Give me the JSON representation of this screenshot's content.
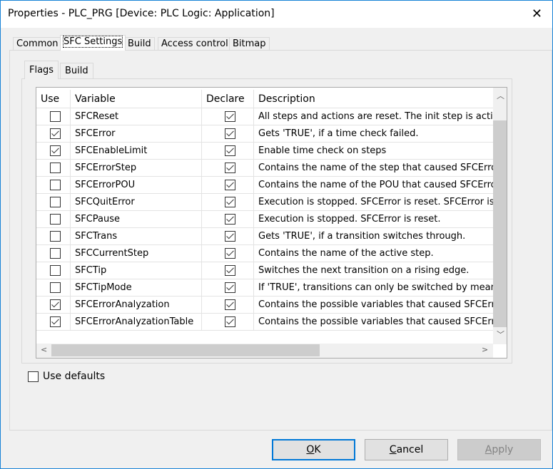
{
  "window": {
    "title": "Properties - PLC_PRG [Device: PLC Logic: Application]",
    "close_icon": "close-icon"
  },
  "tabs": [
    {
      "label": "Common"
    },
    {
      "label": "SFC Settings",
      "active": true
    },
    {
      "label": "Build"
    },
    {
      "label": "Access control"
    },
    {
      "label": "Bitmap"
    }
  ],
  "subtabs": [
    {
      "label": "Flags",
      "active": true
    },
    {
      "label": "Build"
    }
  ],
  "table": {
    "columns": [
      "Use",
      "Variable",
      "Declare",
      "Description"
    ],
    "rows": [
      {
        "use": false,
        "variable": "SFCReset",
        "declare": true,
        "description": "All steps and actions are reset. The init step is activated"
      },
      {
        "use": true,
        "variable": "SFCError",
        "declare": true,
        "description": "Gets 'TRUE', if a time check failed."
      },
      {
        "use": true,
        "variable": "SFCEnableLimit",
        "declare": true,
        "description": "Enable time check on steps"
      },
      {
        "use": false,
        "variable": "SFCErrorStep",
        "declare": true,
        "description": "Contains the name of the step that caused SFCError t"
      },
      {
        "use": false,
        "variable": "SFCErrorPOU",
        "declare": true,
        "description": "Contains the name of the POU that caused SFCError t"
      },
      {
        "use": false,
        "variable": "SFCQuitError",
        "declare": true,
        "description": "Execution is stopped. SFCError is reset. SFCError is re"
      },
      {
        "use": false,
        "variable": "SFCPause",
        "declare": true,
        "description": "Execution is stopped. SFCError is reset."
      },
      {
        "use": false,
        "variable": "SFCTrans",
        "declare": true,
        "description": "Gets 'TRUE', if a transition switches through."
      },
      {
        "use": false,
        "variable": "SFCCurrentStep",
        "declare": true,
        "description": "Contains the name of the active step."
      },
      {
        "use": false,
        "variable": "SFCTip",
        "declare": true,
        "description": "Switches the next transition on a rising edge."
      },
      {
        "use": false,
        "variable": "SFCTipMode",
        "declare": true,
        "description": "If 'TRUE', transitions can only be switched by means c"
      },
      {
        "use": true,
        "variable": "SFCErrorAnalyzation",
        "declare": true,
        "description": "Contains the possible variables that caused SFCError t"
      },
      {
        "use": true,
        "variable": "SFCErrorAnalyzationTable",
        "declare": true,
        "description": "Contains the possible variables that caused SFCError t"
      }
    ]
  },
  "use_defaults": {
    "label": "Use defaults",
    "checked": false
  },
  "buttons": {
    "ok": {
      "accel": "O",
      "rest": "K"
    },
    "cancel": {
      "accel": "C",
      "rest": "ancel"
    },
    "apply": {
      "accel": "A",
      "rest": "pply",
      "disabled": true
    }
  }
}
